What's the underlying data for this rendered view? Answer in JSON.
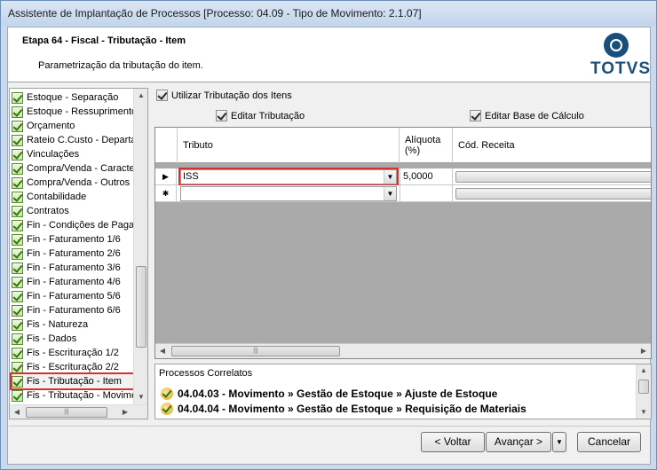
{
  "window": {
    "title": "Assistente de Implantação de Processos [Processo: 04.09 - Tipo de Movimento: 2.1.07]"
  },
  "header": {
    "step_title": "Etapa 64 - Fiscal - Tributação - Item",
    "subtitle": "Parametrização da tributação do item.",
    "logo_text": "TOTVS"
  },
  "steps": {
    "items": [
      {
        "label": "Estoque - Separação"
      },
      {
        "label": "Estoque - Ressuprimento"
      },
      {
        "label": "Orçamento"
      },
      {
        "label": "Rateio C.Custo - Departamento"
      },
      {
        "label": "Vinculações"
      },
      {
        "label": "Compra/Venda - Características"
      },
      {
        "label": "Compra/Venda - Outros"
      },
      {
        "label": "Contabilidade"
      },
      {
        "label": "Contratos"
      },
      {
        "label": "Fin - Condições de Pagamento"
      },
      {
        "label": "Fin - Faturamento 1/6"
      },
      {
        "label": "Fin - Faturamento 2/6"
      },
      {
        "label": "Fin - Faturamento 3/6"
      },
      {
        "label": "Fin - Faturamento 4/6"
      },
      {
        "label": "Fin - Faturamento 5/6"
      },
      {
        "label": "Fin - Faturamento 6/6"
      },
      {
        "label": "Fis - Natureza"
      },
      {
        "label": "Fis - Dados"
      },
      {
        "label": "Fis - Escrituração 1/2"
      },
      {
        "label": "Fis - Escrituração 2/2"
      },
      {
        "label": "Fis - Tributação - Item"
      },
      {
        "label": "Fis - Tributação - Movimento"
      }
    ],
    "selected_index": 20
  },
  "options": {
    "use_item_taxation": "Utilizar Tributação dos Itens",
    "edit_taxation": "Editar Tributação",
    "edit_base": "Editar Base de Cálculo"
  },
  "grid": {
    "columns": [
      "Tributo",
      "Alíquota (%)",
      "Cód. Receita"
    ],
    "rows": [
      {
        "marker": "▶",
        "tributo": "ISS",
        "aliquota": "5,0000",
        "cod_receita": ""
      },
      {
        "marker": "✱",
        "tributo": "",
        "aliquota": "",
        "cod_receita": ""
      }
    ]
  },
  "correlatos": {
    "title": "Processos Correlatos",
    "items": [
      {
        "label": "04.04.03 - Movimento » Gestão de Estoque » Ajuste de Estoque"
      },
      {
        "label": "04.04.04 - Movimento » Gestão de Estoque » Requisição de Materiais"
      }
    ]
  },
  "buttons": {
    "back": "< Voltar",
    "next": "Avançar >",
    "cancel": "Cancelar"
  }
}
